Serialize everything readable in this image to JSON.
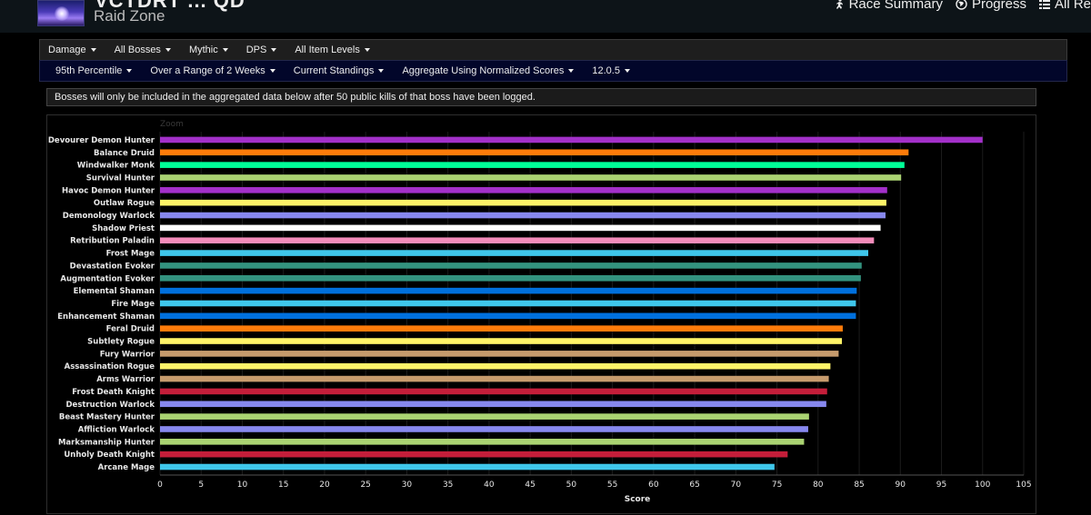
{
  "header": {
    "title_partial": "VCTDRT ... QD",
    "zone_label": "Raid Zone",
    "links": [
      {
        "label": "Race Summary",
        "icon": "runner-icon"
      },
      {
        "label": "Progress",
        "icon": "globe-icon"
      },
      {
        "label": "All Re",
        "icon": "list-icon"
      }
    ]
  },
  "filters_primary": [
    {
      "label": "Damage"
    },
    {
      "label": "All Bosses"
    },
    {
      "label": "Mythic"
    },
    {
      "label": "DPS"
    },
    {
      "label": "All Item Levels"
    }
  ],
  "filters_secondary": [
    {
      "label": "95th Percentile"
    },
    {
      "label": "Over a Range of 2 Weeks"
    },
    {
      "label": "Current Standings"
    },
    {
      "label": "Aggregate Using Normalized Scores"
    },
    {
      "label": "12.0.5"
    }
  ],
  "notice": "Bosses will only be included in the aggregated data below after 50 public kills of that boss have been logged.",
  "chart_data": {
    "type": "bar",
    "orientation": "horizontal",
    "zoom_label": "Zoom",
    "xlabel": "Score",
    "ylabel": "",
    "xlim": [
      0,
      105
    ],
    "xticks": [
      0,
      5,
      10,
      15,
      20,
      25,
      30,
      35,
      40,
      45,
      50,
      55,
      60,
      65,
      70,
      75,
      80,
      85,
      90,
      95,
      100,
      105
    ],
    "grid": true,
    "categories": [
      "Devourer Demon Hunter",
      "Balance Druid",
      "Windwalker Monk",
      "Survival Hunter",
      "Havoc Demon Hunter",
      "Outlaw Rogue",
      "Demonology Warlock",
      "Shadow Priest",
      "Retribution Paladin",
      "Frost Mage",
      "Devastation Evoker",
      "Augmentation Evoker",
      "Elemental Shaman",
      "Fire Mage",
      "Enhancement Shaman",
      "Feral Druid",
      "Subtlety Rogue",
      "Fury Warrior",
      "Assassination Rogue",
      "Arms Warrior",
      "Frost Death Knight",
      "Destruction Warlock",
      "Beast Mastery Hunter",
      "Affliction Warlock",
      "Marksmanship Hunter",
      "Unholy Death Knight",
      "Arcane Mage"
    ],
    "values": [
      100,
      91.0,
      90.5,
      90.1,
      88.4,
      88.3,
      88.2,
      87.6,
      86.8,
      86.1,
      85.3,
      85.2,
      84.7,
      84.6,
      84.6,
      83.0,
      82.9,
      82.5,
      81.5,
      81.3,
      81.1,
      81.0,
      78.9,
      78.8,
      78.3,
      76.3,
      74.7
    ],
    "colors": [
      "#a330c9",
      "#ff7c0a",
      "#00ff98",
      "#aad372",
      "#a330c9",
      "#fff468",
      "#8788ee",
      "#ffffff",
      "#f48cba",
      "#3fc7eb",
      "#33937f",
      "#33937f",
      "#0070dd",
      "#3fc7eb",
      "#0070dd",
      "#ff7c0a",
      "#fff468",
      "#c69b6d",
      "#fff468",
      "#c69b6d",
      "#c41e3a",
      "#8788ee",
      "#aad372",
      "#8788ee",
      "#aad372",
      "#c41e3a",
      "#3fc7eb"
    ]
  }
}
